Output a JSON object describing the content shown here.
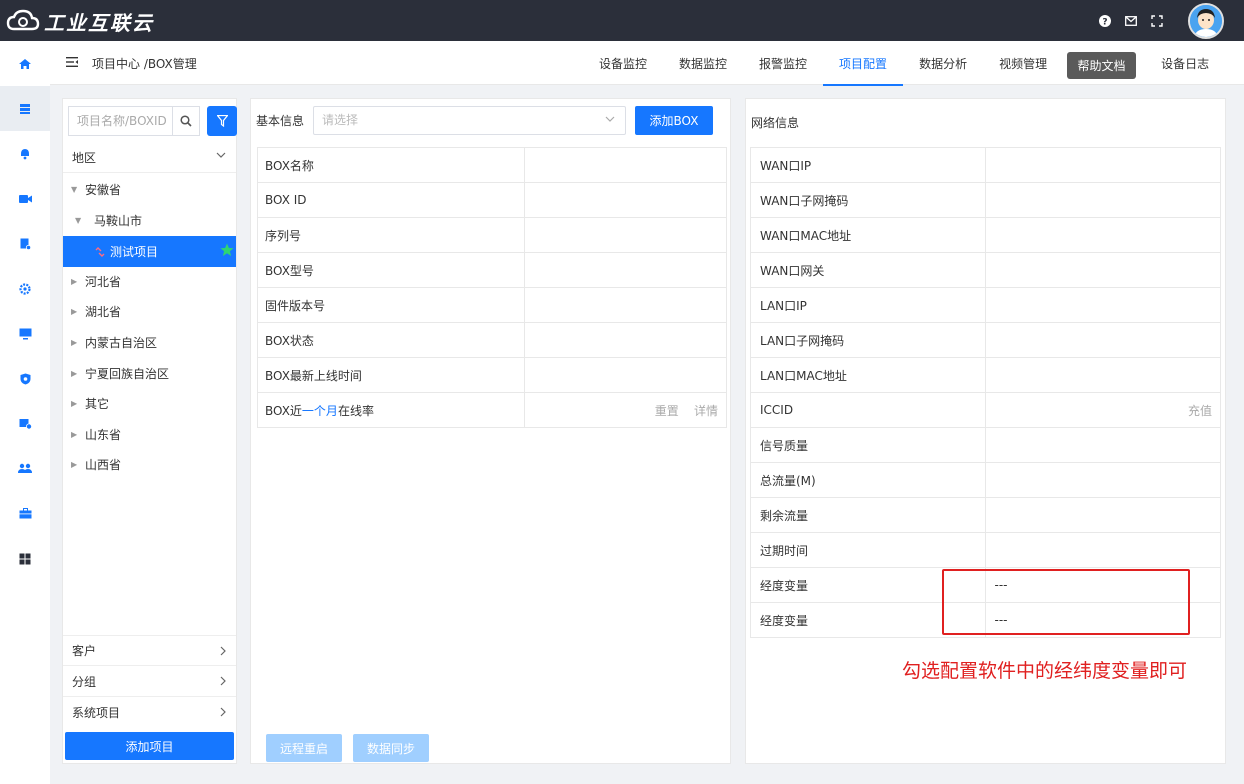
{
  "app": {
    "title": "工业互联云"
  },
  "breadcrumb": "项目中心 /BOX管理",
  "tabs": [
    {
      "label": "设备监控"
    },
    {
      "label": "数据监控"
    },
    {
      "label": "报警监控"
    },
    {
      "label": "项目配置",
      "active": true
    },
    {
      "label": "数据分析"
    },
    {
      "label": "视频管理"
    },
    {
      "label": ""
    },
    {
      "label": "设备日志"
    }
  ],
  "tooltip": "帮助文档",
  "tree": {
    "search_placeholder": "项目名称/BOXID",
    "region_header": "地区",
    "nodes": {
      "anhui": "安徽省",
      "maanshan": "马鞍山市",
      "selected": "测试项目",
      "hebei": "河北省",
      "hubei": "湖北省",
      "neimenggu": "内蒙古自治区",
      "ningxia": "宁夏回族自治区",
      "other": "其它",
      "shandong": "山东省",
      "shanxi": "山西省"
    },
    "customer_header": "客户",
    "group_header": "分组",
    "system_header": "系统项目",
    "add_button": "添加项目"
  },
  "basic": {
    "label": "基本信息",
    "select_placeholder": "请选择",
    "add_button": "添加BOX",
    "rows": {
      "r1": "BOX名称",
      "r2": "BOX ID",
      "r3": "序列号",
      "r4": "BOX型号",
      "r5": "固件版本号",
      "r6": "BOX状态",
      "r7": "BOX最新上线时间",
      "r8_pre": "BOX近",
      "r8_link": "一个月",
      "r8_post": "在线率"
    },
    "reset": "重置",
    "detail": "详情",
    "reboot_button": "远程重启",
    "sync_button": "数据同步"
  },
  "network": {
    "label": "网络信息",
    "rows": {
      "r1": "WAN口IP",
      "r2": "WAN口子网掩码",
      "r3": "WAN口MAC地址",
      "r4": "WAN口网关",
      "r5": "LAN口IP",
      "r6": "LAN口子网掩码",
      "r7": "LAN口MAC地址",
      "r8": "ICCID",
      "r9": "信号质量",
      "r10": "总流量(M)",
      "r11": "剩余流量",
      "r12": "过期时间",
      "r13": "经度变量",
      "r14": "经度变量"
    },
    "recharge": "充值",
    "var1_value": "---",
    "var2_value": "---"
  },
  "annotation": "勾选配置软件中的经纬度变量即可",
  "colors": {
    "primary": "#1677ff",
    "topbar": "#2b2f3a",
    "annotation": "#e02020"
  }
}
